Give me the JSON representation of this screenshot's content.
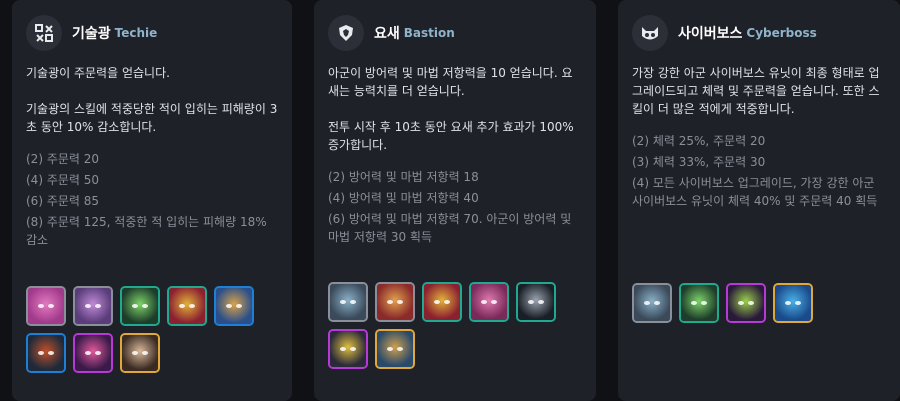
{
  "cards": [
    {
      "name": "기술광",
      "name_en": "Techie",
      "icon": "techie-icon",
      "desc": [
        "기술광이 주문력을 얻습니다.",
        "기술광의 스킬에 적중당한 적이 입히는 피해량이 3초 동안 10% 감소합니다."
      ],
      "tiers": [
        "(2) 주문력 20",
        "(4) 주문력 50",
        "(6) 주문력 85",
        "(8) 주문력 125, 적중한 적 입히는 피해량 18% 감소"
      ],
      "champions": [
        {
          "name": "champion-1",
          "border": "#8a8f99",
          "colors": [
            "#a23a8c",
            "#e27ac0"
          ]
        },
        {
          "name": "champion-2",
          "border": "#8a8f99",
          "colors": [
            "#5a3d7a",
            "#c08ad6"
          ]
        },
        {
          "name": "champion-3",
          "border": "#1fa98e",
          "colors": [
            "#1d3d2a",
            "#7ed36a"
          ]
        },
        {
          "name": "champion-4",
          "border": "#1fa98e",
          "colors": [
            "#8b2030",
            "#e2b23a"
          ]
        },
        {
          "name": "champion-5",
          "border": "#1e7fd6",
          "colors": [
            "#2a4f8a",
            "#d9a24a"
          ]
        },
        {
          "name": "champion-6",
          "border": "#1e7fd6",
          "colors": [
            "#1e2a3a",
            "#c0502a"
          ]
        },
        {
          "name": "champion-7",
          "border": "#b73ad6",
          "colors": [
            "#3a1a4a",
            "#e05a9a"
          ]
        },
        {
          "name": "champion-8",
          "border": "#e0a83a",
          "colors": [
            "#3a2a22",
            "#d8b89a"
          ]
        }
      ]
    },
    {
      "name": "요새",
      "name_en": "Bastion",
      "icon": "bastion-icon",
      "desc": [
        "아군이 방어력 및 마법 저항력을 10 얻습니다. 요새는 능력치를 더 얻습니다.",
        "전투 시작 후 10초 동안 요새 추가 효과가 100% 증가합니다."
      ],
      "tiers": [
        "(2) 방어력 및 마법 저항력 18",
        "(4) 방어력 및 마법 저항력 40",
        "(6) 방어력 및 마법 저항력 70. 아군이 방어력 및 마법 저항력 30 획득"
      ],
      "champions": [
        {
          "name": "champion-1",
          "border": "#8a8f99",
          "colors": [
            "#3a4a5a",
            "#8ab0c8"
          ]
        },
        {
          "name": "champion-2",
          "border": "#8a8f99",
          "colors": [
            "#8a2a2a",
            "#e0a050"
          ]
        },
        {
          "name": "champion-3",
          "border": "#1fa98e",
          "colors": [
            "#8b2030",
            "#e2b23a"
          ]
        },
        {
          "name": "champion-4",
          "border": "#1fa98e",
          "colors": [
            "#7a2a5a",
            "#e07ab0"
          ]
        },
        {
          "name": "champion-5",
          "border": "#1fa98e",
          "colors": [
            "#1a1e26",
            "#9aa4b0"
          ]
        },
        {
          "name": "champion-6",
          "border": "#b73ad6",
          "colors": [
            "#2a2a3a",
            "#e0c040"
          ]
        },
        {
          "name": "champion-7",
          "border": "#e0a83a",
          "colors": [
            "#2a4a6a",
            "#d0a050"
          ]
        }
      ]
    },
    {
      "name": "사이버보스",
      "name_en": "Cyberboss",
      "icon": "cyberboss-icon",
      "desc": [
        "가장 강한 아군 사이버보스 유닛이 최종 형태로 업그레이드되고 체력 및 주문력을 얻습니다. 또한 스킬이 더 많은 적에게 적중합니다."
      ],
      "tiers": [
        "(2) 체력 25%, 주문력 20",
        "(3) 체력 33%, 주문력 30",
        "(4) 모든 사이버보스 업그레이드, 가장 강한 아군 사이버보스 유닛이 체력 40% 및 주문력 40 획득"
      ],
      "champions": [
        {
          "name": "champion-1",
          "border": "#8a8f99",
          "colors": [
            "#3a4a5a",
            "#8ab0c8"
          ]
        },
        {
          "name": "champion-2",
          "border": "#1fa98e",
          "colors": [
            "#1d3d2a",
            "#7ed36a"
          ]
        },
        {
          "name": "champion-3",
          "border": "#b73ad6",
          "colors": [
            "#2a1a3a",
            "#9ad04a"
          ]
        },
        {
          "name": "champion-4",
          "border": "#e0a83a",
          "colors": [
            "#1a4a8a",
            "#4ab0e8"
          ]
        }
      ]
    }
  ]
}
